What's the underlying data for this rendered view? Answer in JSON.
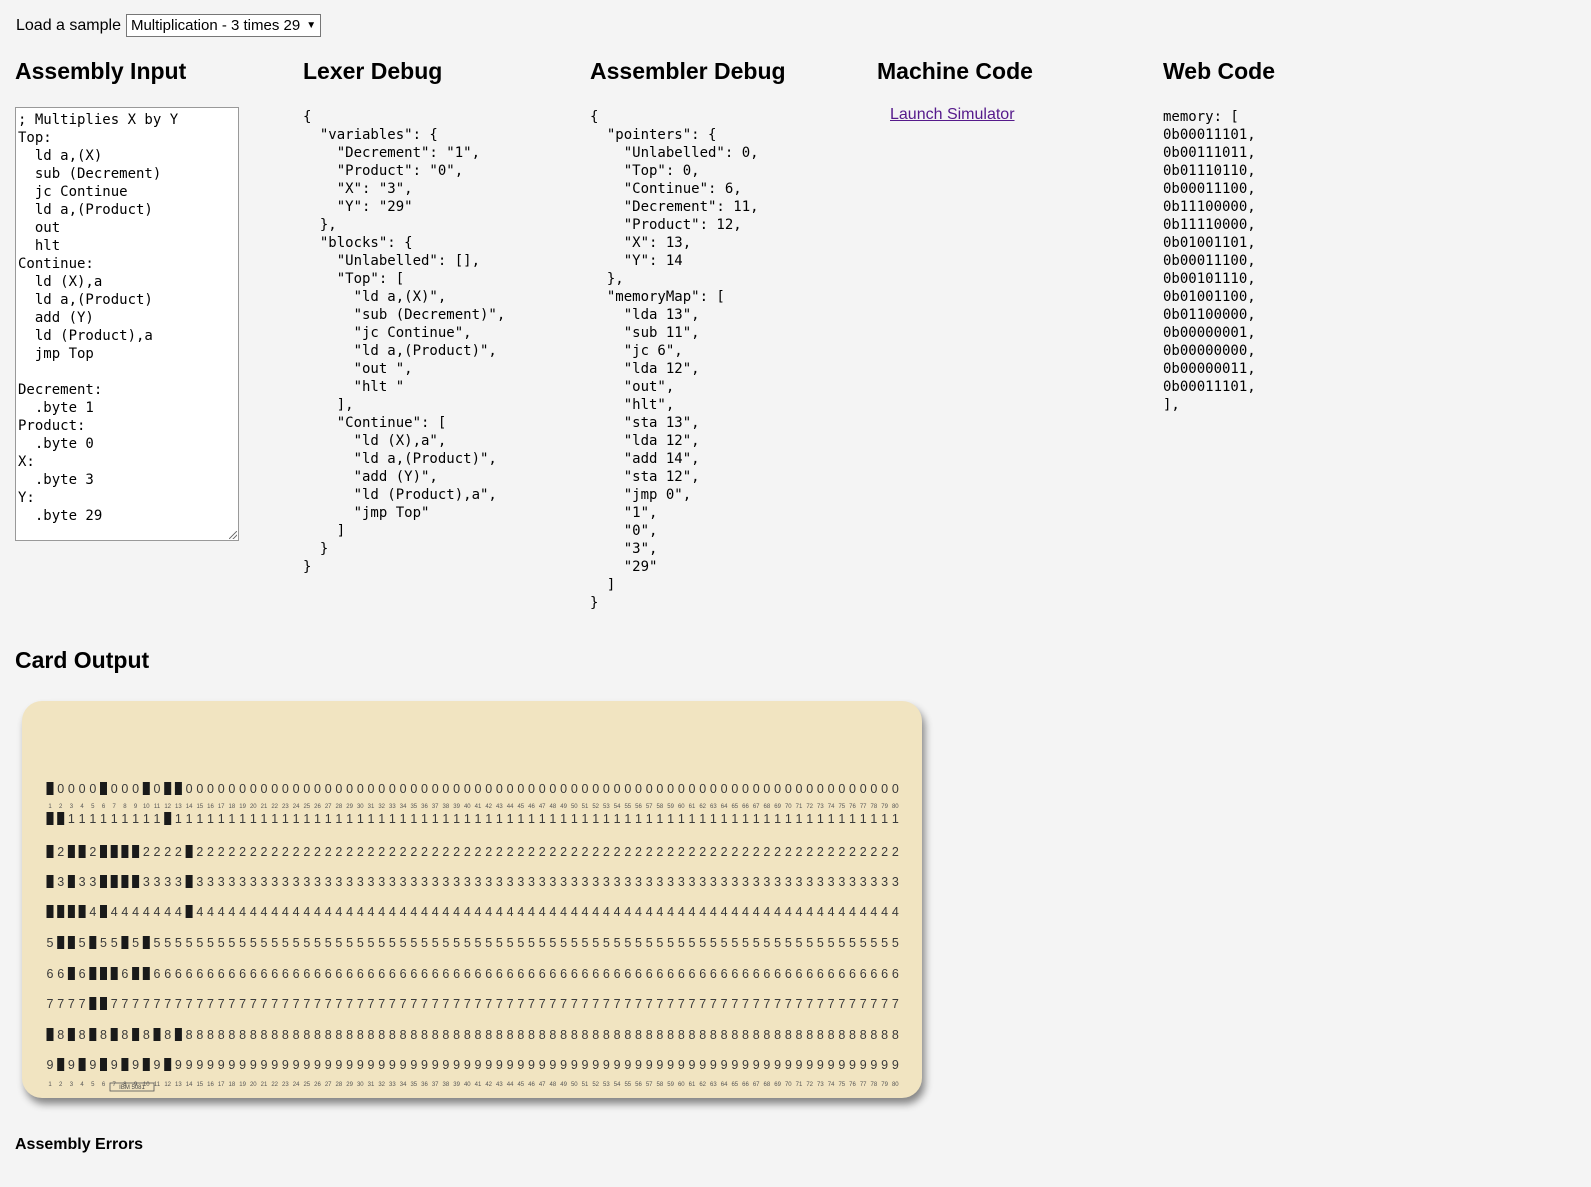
{
  "sample_selector": {
    "label": "Load a sample",
    "selected": "Multiplication - 3 times 29"
  },
  "assembly_input": {
    "heading": "Assembly Input",
    "code": "; Multiplies X by Y\nTop:\n  ld a,(X)\n  sub (Decrement)\n  jc Continue\n  ld a,(Product)\n  out\n  hlt\nContinue:\n  ld (X),a\n  ld a,(Product)\n  add (Y)\n  ld (Product),a\n  jmp Top\n\nDecrement:\n  .byte 1\nProduct:\n  .byte 0\nX:\n  .byte 3\nY:\n  .byte 29"
  },
  "lexer_debug": {
    "heading": "Lexer Debug",
    "json": "{\n  \"variables\": {\n    \"Decrement\": \"1\",\n    \"Product\": \"0\",\n    \"X\": \"3\",\n    \"Y\": \"29\"\n  },\n  \"blocks\": {\n    \"Unlabelled\": [],\n    \"Top\": [\n      \"ld a,(X)\",\n      \"sub (Decrement)\",\n      \"jc Continue\",\n      \"ld a,(Product)\",\n      \"out \",\n      \"hlt \"\n    ],\n    \"Continue\": [\n      \"ld (X),a\",\n      \"ld a,(Product)\",\n      \"add (Y)\",\n      \"ld (Product),a\",\n      \"jmp Top\"\n    ]\n  }\n}"
  },
  "assembler_debug": {
    "heading": "Assembler Debug",
    "json": "{\n  \"pointers\": {\n    \"Unlabelled\": 0,\n    \"Top\": 0,\n    \"Continue\": 6,\n    \"Decrement\": 11,\n    \"Product\": 12,\n    \"X\": 13,\n    \"Y\": 14\n  },\n  \"memoryMap\": [\n    \"lda 13\",\n    \"sub 11\",\n    \"jc 6\",\n    \"lda 12\",\n    \"out\",\n    \"hlt\",\n    \"sta 13\",\n    \"lda 12\",\n    \"add 14\",\n    \"sta 12\",\n    \"jmp 0\",\n    \"1\",\n    \"0\",\n    \"3\",\n    \"29\"\n  ]\n}"
  },
  "machine_code": {
    "heading": "Machine Code",
    "link": "Launch Simulator"
  },
  "web_code": {
    "heading": "Web Code",
    "code": "memory: [\n0b00011101,\n0b00111011,\n0b01110110,\n0b00011100,\n0b11100000,\n0b11110000,\n0b01001101,\n0b00011100,\n0b00101110,\n0b01001100,\n0b01100000,\n0b00000001,\n0b00000000,\n0b00000011,\n0b00011101,\n],"
  },
  "card_output": {
    "heading": "Card Output",
    "maker_label": "IBM 5081",
    "row_digits": [
      "0",
      "1",
      "2",
      "3",
      "4",
      "5",
      "6",
      "7",
      "8",
      "9"
    ],
    "punched_rows": [
      [
        1,
        6,
        10,
        12,
        13
      ],
      [
        1,
        2,
        12
      ],
      [
        1,
        3,
        4,
        6,
        7,
        8,
        9,
        14
      ],
      [
        1,
        3,
        6,
        7,
        8,
        9,
        14
      ],
      [
        1,
        2,
        3,
        4,
        6,
        14
      ],
      [
        2,
        3,
        5,
        8,
        10
      ],
      [
        3,
        5,
        6,
        7,
        9,
        10
      ],
      [
        5,
        6
      ],
      [
        1,
        3,
        5,
        7,
        9,
        11,
        13
      ],
      [
        2,
        4,
        6,
        8,
        10,
        12
      ]
    ],
    "columns": 80
  },
  "errors": {
    "heading": "Assembly Errors"
  }
}
